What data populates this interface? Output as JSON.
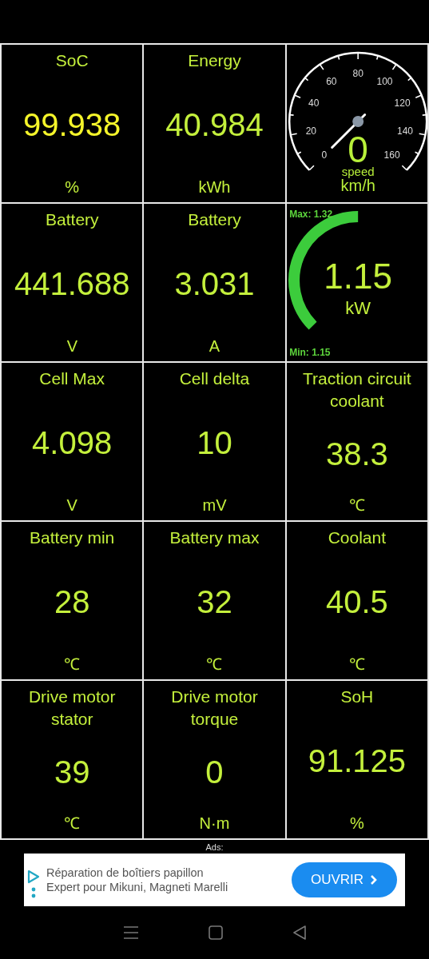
{
  "cells": [
    {
      "kind": "value",
      "label": "SoC",
      "value": "99.938",
      "unit": "%",
      "color": "#f5f52a"
    },
    {
      "kind": "value",
      "label": "Energy",
      "value": "40.984",
      "unit": "kWh",
      "color": "#c4f03c"
    },
    {
      "kind": "speedometer",
      "scale": [
        "0",
        "20",
        "40",
        "60",
        "80",
        "100",
        "120",
        "140",
        "160"
      ],
      "value": "0",
      "label": "speed",
      "unit": "km/h"
    },
    {
      "kind": "value",
      "label": "Battery",
      "value": "441.688",
      "unit": "V",
      "color": "#c4f03c"
    },
    {
      "kind": "value",
      "label": "Battery",
      "value": "3.031",
      "unit": "A",
      "color": "#c4f03c"
    },
    {
      "kind": "power-gauge",
      "max": "Max: 1.32",
      "min": "Min: 1.15",
      "value": "1.15",
      "unit": "kW"
    },
    {
      "kind": "value",
      "label": "Cell Max",
      "value": "4.098",
      "unit": "V",
      "color": "#c4f03c"
    },
    {
      "kind": "value",
      "label": "Cell delta",
      "value": "10",
      "unit": "mV",
      "color": "#c4f03c"
    },
    {
      "kind": "value",
      "label": "Traction circuit coolant",
      "value": "38.3",
      "unit": "℃",
      "color": "#c4f03c"
    },
    {
      "kind": "value",
      "label": "Battery min",
      "value": "28",
      "unit": "℃",
      "color": "#c4f03c"
    },
    {
      "kind": "value",
      "label": "Battery max",
      "value": "32",
      "unit": "℃",
      "color": "#c4f03c"
    },
    {
      "kind": "value",
      "label": "Coolant",
      "value": "40.5",
      "unit": "℃",
      "color": "#c4f03c"
    },
    {
      "kind": "value",
      "label": "Drive motor stator",
      "value": "39",
      "unit": "℃",
      "color": "#c4f03c"
    },
    {
      "kind": "value",
      "label": "Drive motor torque",
      "value": "0",
      "unit": "N·m",
      "color": "#c4f03c"
    },
    {
      "kind": "value",
      "label": "SoH",
      "value": "91.125",
      "unit": "%",
      "color": "#c4f03c"
    }
  ],
  "ad": {
    "label": "Ads:",
    "lines": [
      "Réparation de boîtiers papillon",
      "Expert pour Mikuni, Magneti Marelli"
    ],
    "button": "OUVRIR"
  }
}
